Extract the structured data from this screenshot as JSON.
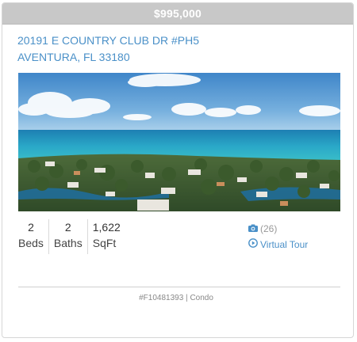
{
  "listing": {
    "price": "$995,000",
    "address_line1": "20191 E COUNTRY CLUB DR #PH5",
    "address_line2": "AVENTURA, FL 33180",
    "beds": {
      "value": "2",
      "label": "Beds"
    },
    "baths": {
      "value": "2",
      "label": "Baths"
    },
    "sqft": {
      "value": "1,622",
      "label": "SqFt"
    },
    "photo_count": "(26)",
    "virtual_tour_label": "Virtual Tour",
    "mls_id": "#F10481393",
    "separator": "|",
    "property_type": "Condo"
  },
  "icons": {
    "camera": "camera-icon",
    "play": "play-circle-icon"
  },
  "colors": {
    "link": "#4a90c8",
    "price_bar": "#c8c8c8",
    "muted": "#999999"
  }
}
